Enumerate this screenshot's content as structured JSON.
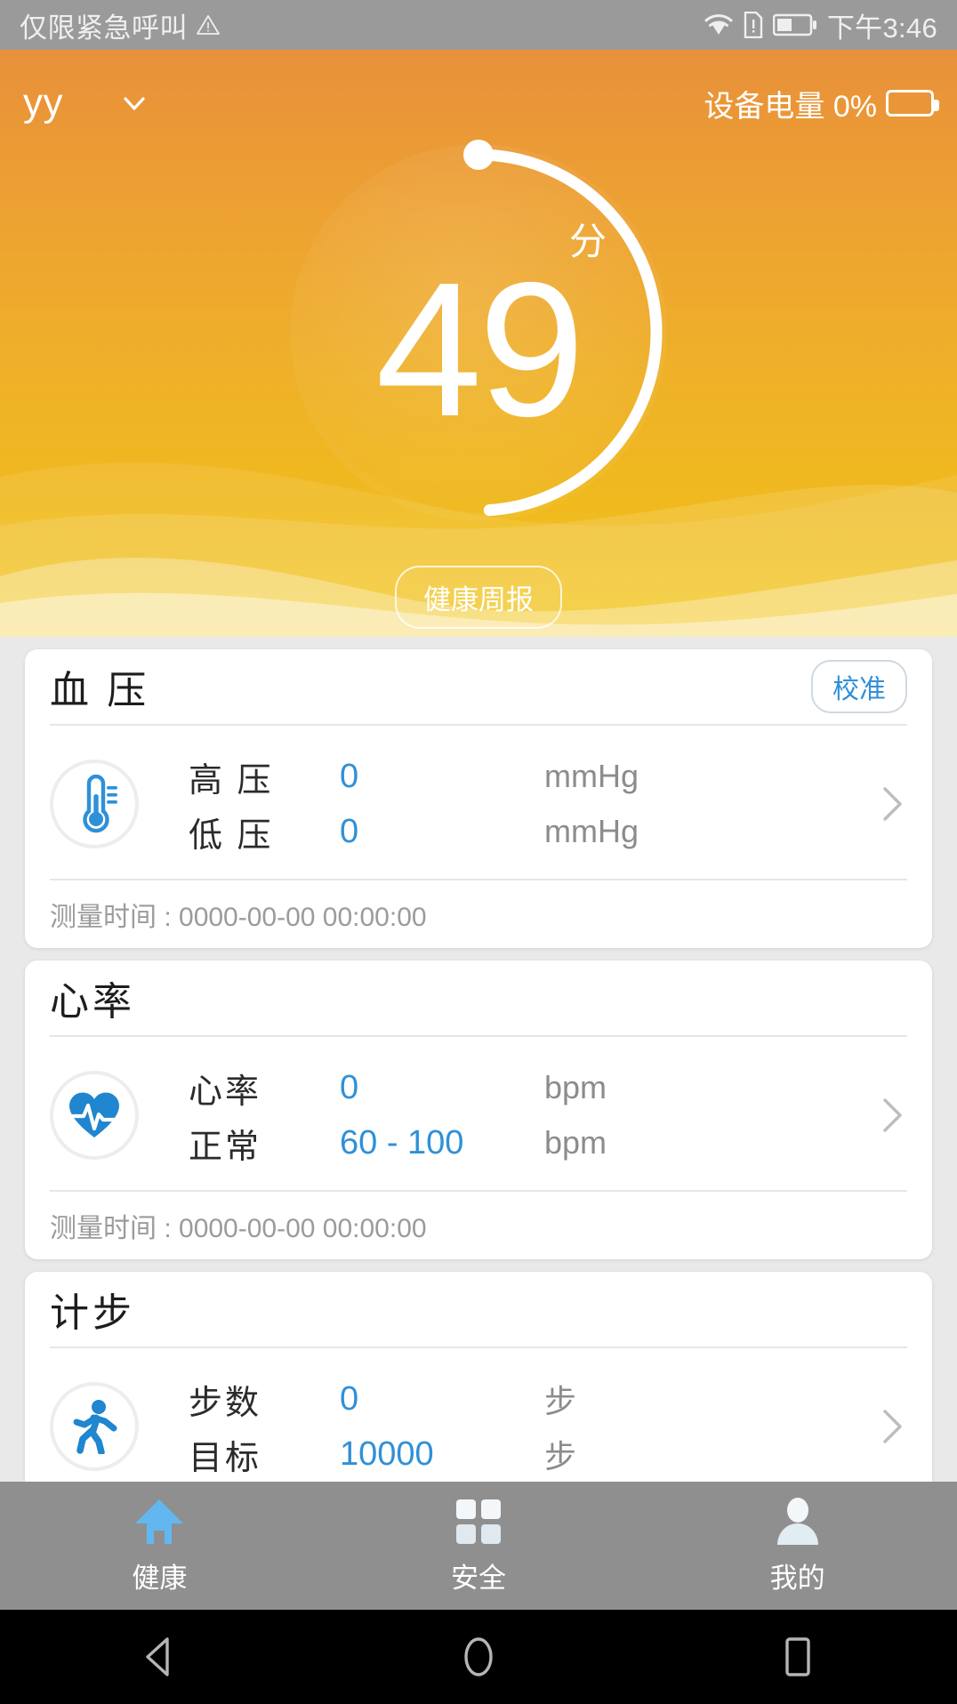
{
  "status_bar": {
    "carrier_text": "仅限紧急呼叫",
    "warning_icon": "warning-triangle-icon",
    "wifi_icon": "wifi-icon",
    "sim_icon": "sim-alert-icon",
    "battery_icon": "battery-icon",
    "time": "下午3:46"
  },
  "header": {
    "user_name": "yy",
    "dropdown_icon": "chevron-down-icon",
    "device_battery_label": "设备电量 0%",
    "battery_icon": "battery-outline-icon"
  },
  "score": {
    "value": "49",
    "unit": "分",
    "progress_percent": 49,
    "weekly_report_label": "健康周报"
  },
  "cards": [
    {
      "id": "blood-pressure",
      "title": "血 压",
      "action_label": "校准",
      "icon": "thermometer-icon",
      "rows": [
        {
          "label": "高 压",
          "value": "0",
          "unit": "mmHg"
        },
        {
          "label": "低 压",
          "value": "0",
          "unit": "mmHg"
        }
      ],
      "footer": "测量时间 : 0000-00-00 00:00:00"
    },
    {
      "id": "heart-rate",
      "title": "心率",
      "action_label": "",
      "icon": "heart-pulse-icon",
      "rows": [
        {
          "label": "心率",
          "value": "0",
          "unit": "bpm"
        },
        {
          "label": "正常",
          "value": "60 - 100",
          "unit": "bpm"
        }
      ],
      "footer": "测量时间 : 0000-00-00 00:00:00"
    },
    {
      "id": "step-counter",
      "title": "计步",
      "action_label": "",
      "icon": "running-person-icon",
      "rows": [
        {
          "label": "步数",
          "value": "0",
          "unit": "步"
        },
        {
          "label": "目标",
          "value": "10000",
          "unit": "步"
        }
      ],
      "footer": ""
    }
  ],
  "tabs": [
    {
      "label": "健康",
      "icon": "home-icon",
      "active": true
    },
    {
      "label": "安全",
      "icon": "grid-squares-icon",
      "active": false
    },
    {
      "label": "我的",
      "icon": "person-icon",
      "active": false
    }
  ],
  "android_nav": {
    "back_icon": "back-triangle-icon",
    "home_icon": "home-circle-icon",
    "recents_icon": "recents-square-icon"
  },
  "colors": {
    "accent_blue": "#2f90d8",
    "hero_top": "#e8903a",
    "hero_bottom": "#f3c81d",
    "status_bar": "#9a9a9a",
    "tabbar": "#8f8f8f"
  }
}
